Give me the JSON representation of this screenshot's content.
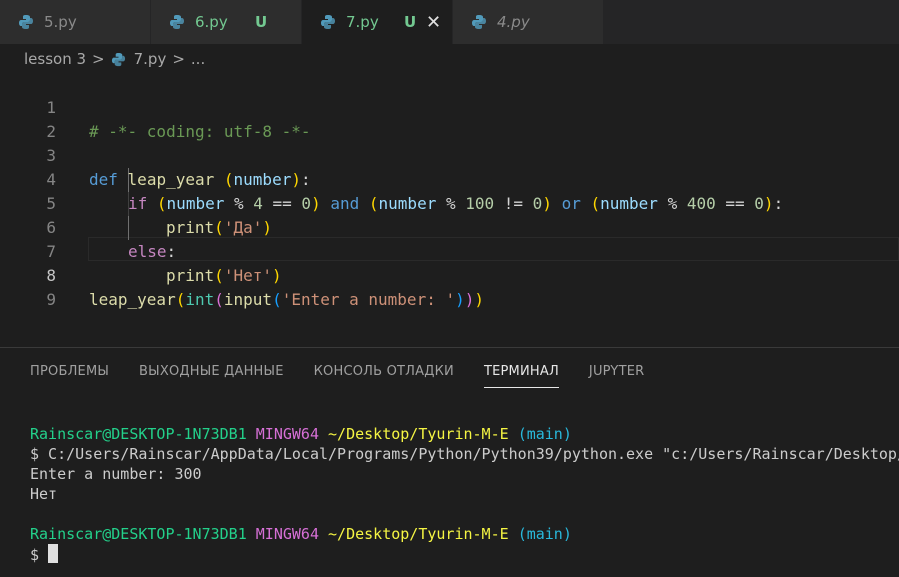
{
  "tabs": [
    {
      "name": "5.py",
      "status": "",
      "style": "normal"
    },
    {
      "name": "6.py",
      "status": "U",
      "style": "normal"
    },
    {
      "name": "7.py",
      "status": "U",
      "style": "active"
    },
    {
      "name": "4.py",
      "status": "",
      "style": "italic"
    }
  ],
  "breadcrumb": {
    "folder": "lesson 3",
    "sep1": ">",
    "file": "7.py",
    "sep2": ">",
    "more": "..."
  },
  "editor": {
    "line_numbers": [
      "1",
      "2",
      "3",
      "4",
      "5",
      "6",
      "7",
      "8",
      "9"
    ],
    "l1": "# -*- coding: utf-8 -*-",
    "l3": {
      "def": "def",
      "fn": "leap_year",
      "lp": "(",
      "param": "number",
      "rp": ")",
      "colon": ":"
    },
    "l4": {
      "if": "if",
      "p1": "(",
      "v1": "number",
      "o1": " % ",
      "n1": "4",
      "o2": " == ",
      "n2": "0",
      "p2": ")",
      "and": "and",
      "p3": "(",
      "v2": "number",
      "o3": " % ",
      "n3": "100",
      "o4": " != ",
      "n4": "0",
      "p4": ")",
      "or": "or",
      "p5": "(",
      "v3": "number",
      "o5": " % ",
      "n5": "400",
      "o6": " == ",
      "n6": "0",
      "p6": ")",
      "colon": ":"
    },
    "l5": {
      "fn": "print",
      "lp": "(",
      "str": "'Да'",
      "rp": ")"
    },
    "l6": {
      "else": "else",
      "colon": ":"
    },
    "l7": {
      "fn": "print",
      "lp": "(",
      "str": "'Нет'",
      "rp": ")"
    },
    "l8": {
      "fn": "leap_year",
      "p1": "(",
      "int": "int",
      "p2": "(",
      "input": "input",
      "p3": "(",
      "str": "'Enter a number: '",
      "p4": ")",
      "p5": ")",
      "p6": ")"
    }
  },
  "panel": {
    "tabs": [
      "ПРОБЛЕМЫ",
      "ВЫХОДНЫЕ ДАННЫЕ",
      "КОНСОЛЬ ОТЛАДКИ",
      "ТЕРМИНАЛ",
      "JUPYTER"
    ],
    "active_tab": "ТЕРМИНАЛ"
  },
  "terminal": {
    "user": "Rainscar@DESKTOP-1N73DB1",
    "shell": "MINGW64",
    "path": "~/Desktop/Tyurin-M-E",
    "branch": "(main)",
    "cmd": "$ C:/Users/Rainscar/AppData/Local/Programs/Python/Python39/python.exe \"c:/Users/Rainscar/Desktop/",
    "out1": "Enter a number: 300",
    "out2": "Нет",
    "prompt": "$ "
  },
  "colors": {
    "accent_untracked": "#73c991",
    "editor_bg": "#1e1e1e",
    "tab_inactive_bg": "#2d2d2d"
  }
}
